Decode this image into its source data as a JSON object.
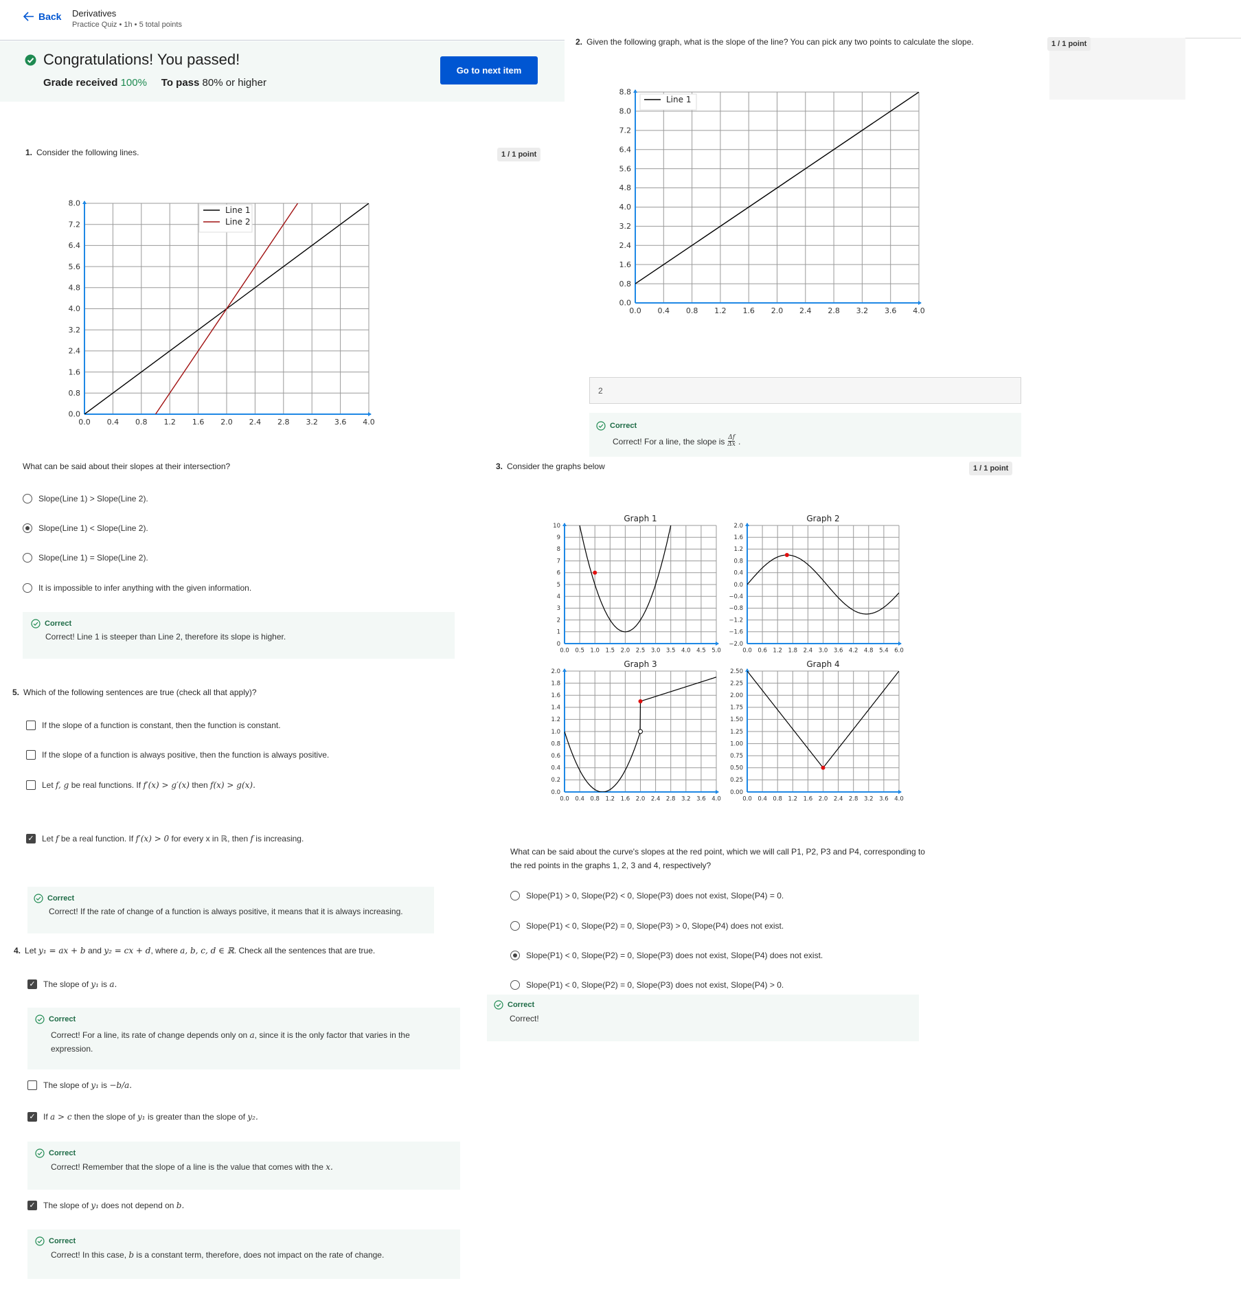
{
  "header": {
    "back_label": "Back",
    "title": "Derivatives",
    "subtitle": "Practice Quiz • 1h • 5 total points"
  },
  "banner": {
    "title": "Congratulations! You passed!",
    "grade_label": "Grade received",
    "grade_value": "100%",
    "pass_label": "To pass",
    "pass_value": "80% or higher",
    "next_button": "Go to next item"
  },
  "colors": {
    "accent": "#0056d2",
    "success": "#1e8a51",
    "feedback_bg": "#f3f8f6",
    "axis": "#1e88e5",
    "red_line": "#a01010"
  },
  "q1": {
    "number": "1.",
    "prompt": "Consider the following lines.",
    "points": "1 / 1 point",
    "question": "What can be said about their slopes at their intersection?",
    "options": [
      {
        "label": "Slope(Line 1) > Slope(Line 2).",
        "selected": false
      },
      {
        "label": "Slope(Line 1) < Slope(Line 2).",
        "selected": true
      },
      {
        "label": "Slope(Line 1) = Slope(Line 2).",
        "selected": false
      },
      {
        "label": "It is impossible to infer anything with the given information.",
        "selected": false
      }
    ],
    "feedback_title": "Correct",
    "feedback_body": "Correct! Line 1 is steeper than Line 2, therefore its slope is higher."
  },
  "q2": {
    "number": "2.",
    "prompt": "Given the following graph, what is the slope of the line? You can pick any two points to calculate the slope.",
    "points": "1 / 1 point",
    "answer": "2",
    "feedback_title": "Correct",
    "feedback_body": "Correct! For a line, the slope is"
  },
  "q3": {
    "number": "3.",
    "prompt": "Consider the graphs below",
    "points": "1 / 1 point",
    "question_line1": "What can be said about the curve's slopes at the red point, which we will call P1, P2, P3 and P4, corresponding to",
    "question_line2": "the red points in the graphs 1, 2, 3 and 4, respectively?",
    "options": [
      {
        "label": "Slope(P1) > 0, Slope(P2) < 0, Slope(P3) does not exist, Slope(P4) = 0.",
        "selected": false
      },
      {
        "label": "Slope(P1) < 0, Slope(P2) = 0, Slope(P3) > 0, Slope(P4) does not exist.",
        "selected": false
      },
      {
        "label": "Slope(P1) < 0, Slope(P2) = 0, Slope(P3) does not exist, Slope(P4) does not exist.",
        "selected": true
      },
      {
        "label": "Slope(P1) < 0, Slope(P2) = 0, Slope(P3) does not exist, Slope(P4) > 0.",
        "selected": false
      }
    ],
    "feedback_title": "Correct",
    "feedback_body": "Correct!"
  },
  "q5": {
    "number": "5.",
    "prompt": "Which of the following sentences are true (check all that apply)?",
    "opt1": "If the slope of a function is constant, then the function is constant.",
    "opt2": "If the slope of a function is always positive, then the function is always positive.",
    "opt3_a": "Let",
    "opt3_fg": "f, g",
    "opt3_b": "be real functions. If",
    "opt3_m1": "f′(x) > g′(x)",
    "opt3_c": "then",
    "opt3_m2": "f(x) > g(x).",
    "opt4_a": "Let",
    "opt4_f": "f",
    "opt4_b": "be a real function. If",
    "opt4_m": "f′(x) > 0",
    "opt4_c": "for every x in",
    "opt4_r": "ℝ",
    "opt4_d": ", then",
    "opt4_f2": "f",
    "opt4_e": "is increasing.",
    "checked": [
      false,
      false,
      false,
      true
    ],
    "feedback_title": "Correct",
    "feedback_body": "Correct! If the rate of change of a function is always positive, it means that it is always increasing."
  },
  "q4": {
    "number": "4.",
    "p_a": "Let",
    "p_m1": "y₁ = ax + b",
    "p_b": "and",
    "p_m2": "y₂ = cx + d",
    "p_c": ", where",
    "p_m3": "a, b, c, d ∈ ℝ",
    "p_d": ". Check all the sentences that are true.",
    "o1_a": "The slope of",
    "o1_m1": "y₁",
    "o1_b": "is",
    "o1_m2": "a.",
    "fb1_title": "Correct",
    "fb1_a": "Correct! For a line, its rate of change depends only on",
    "fb1_m": "a",
    "fb1_b": ", since it is the only factor that varies in the",
    "fb1_c": "expression.",
    "o2_a": "The slope of",
    "o2_m1": "y₁",
    "o2_b": "is",
    "o2_m2": "−b/a.",
    "o3_a": "If",
    "o3_m1": "a > c",
    "o3_b": "then the slope of",
    "o3_m2": "y₁",
    "o3_c": "is greater than the slope of",
    "o3_m3": "y₂.",
    "fb3_title": "Correct",
    "fb3_a": "Correct! Remember that the slope of a line is the value that comes with the",
    "fb3_m": "x.",
    "o4_a": "The slope of",
    "o4_m1": "y₁",
    "o4_b": "does not depend on",
    "o4_m2": "b.",
    "fb4_title": "Correct",
    "fb4_a": "Correct! In this case,",
    "fb4_m": "b",
    "fb4_b": "is a constant term, therefore, does not impact on the rate of change.",
    "checked": [
      true,
      false,
      true,
      true
    ]
  },
  "chart_data": [
    {
      "type": "line",
      "id": "q1-chart",
      "series": [
        {
          "name": "Line 1",
          "color": "#000000",
          "x": [
            0,
            4
          ],
          "y": [
            0,
            8
          ]
        },
        {
          "name": "Line 2",
          "color": "#a01010",
          "x": [
            1,
            3
          ],
          "y": [
            0,
            8
          ]
        }
      ],
      "xlim": [
        0,
        4
      ],
      "ylim": [
        0,
        8
      ],
      "xticks": [
        "0.0",
        "0.4",
        "0.8",
        "1.2",
        "1.6",
        "2.0",
        "2.4",
        "2.8",
        "3.2",
        "3.6",
        "4.0"
      ],
      "yticks": [
        "0.0",
        "0.8",
        "1.6",
        "2.4",
        "3.2",
        "4.0",
        "4.8",
        "5.6",
        "6.4",
        "7.2",
        "8.0"
      ],
      "grid": true,
      "legend": "top-center"
    },
    {
      "type": "line",
      "id": "q2-chart",
      "series": [
        {
          "name": "Line 1",
          "color": "#000000",
          "x": [
            0,
            4
          ],
          "y": [
            0.8,
            8.8
          ]
        }
      ],
      "xlim": [
        0,
        4
      ],
      "ylim": [
        0,
        8.8
      ],
      "xticks": [
        "0.0",
        "0.4",
        "0.8",
        "1.2",
        "1.6",
        "2.0",
        "2.4",
        "2.8",
        "3.2",
        "3.6",
        "4.0"
      ],
      "yticks": [
        "0.0",
        "0.8",
        "1.6",
        "2.4",
        "3.2",
        "4.0",
        "4.8",
        "5.6",
        "6.4",
        "7.2",
        "8.0",
        "8.8"
      ],
      "grid": true,
      "legend": "top-left"
    },
    {
      "type": "line",
      "id": "graph1",
      "title": "Graph 1",
      "function": "4*(x-2)^2+1",
      "red_point": [
        1,
        6
      ],
      "xlim": [
        0,
        5
      ],
      "ylim": [
        0,
        10
      ],
      "xticks": [
        "0.0",
        "0.5",
        "1.0",
        "1.5",
        "2.0",
        "2.5",
        "3.0",
        "3.5",
        "4.0",
        "4.5",
        "5.0"
      ],
      "yticks": [
        "0",
        "1",
        "2",
        "3",
        "4",
        "5",
        "6",
        "7",
        "8",
        "9",
        "10"
      ]
    },
    {
      "type": "line",
      "id": "graph2",
      "title": "Graph 2",
      "function": "sin(x)",
      "red_point": [
        1.5708,
        1
      ],
      "xlim": [
        0,
        6
      ],
      "ylim": [
        -2,
        2
      ],
      "xticks": [
        "0.0",
        "0.6",
        "1.2",
        "1.8",
        "2.4",
        "3.0",
        "3.6",
        "4.2",
        "4.8",
        "5.4",
        "6.0"
      ],
      "yticks": [
        "−2.0",
        "−1.6",
        "−1.2",
        "−0.8",
        "−0.4",
        "0.0",
        "0.4",
        "0.8",
        "1.2",
        "1.6",
        "2.0"
      ]
    },
    {
      "type": "line",
      "id": "graph3",
      "title": "Graph 3",
      "function": "x<2: (x-1)^2 ; x>=2: 1.5+0.2*(x-2)",
      "red_point": [
        2,
        1.5
      ],
      "open_point": [
        2,
        1
      ],
      "xlim": [
        0,
        4
      ],
      "ylim": [
        0,
        2
      ],
      "xticks": [
        "0.0",
        "0.4",
        "0.8",
        "1.2",
        "1.6",
        "2.0",
        "2.4",
        "2.8",
        "3.2",
        "3.6",
        "4.0"
      ],
      "yticks": [
        "0.0",
        "0.2",
        "0.4",
        "0.6",
        "0.8",
        "1.0",
        "1.2",
        "1.4",
        "1.6",
        "1.8",
        "2.0"
      ]
    },
    {
      "type": "line",
      "id": "graph4",
      "title": "Graph 4",
      "function": "abs(x-2)+0.5",
      "red_point": [
        2,
        0.5
      ],
      "xlim": [
        0,
        4
      ],
      "ylim": [
        0,
        2.5
      ],
      "xticks": [
        "0.0",
        "0.4",
        "0.8",
        "1.2",
        "1.6",
        "2.0",
        "2.4",
        "2.8",
        "3.2",
        "3.6",
        "4.0"
      ],
      "yticks": [
        "0.00",
        "0.25",
        "0.50",
        "0.75",
        "1.00",
        "1.25",
        "1.50",
        "1.75",
        "2.00",
        "2.25",
        "2.50"
      ]
    }
  ]
}
